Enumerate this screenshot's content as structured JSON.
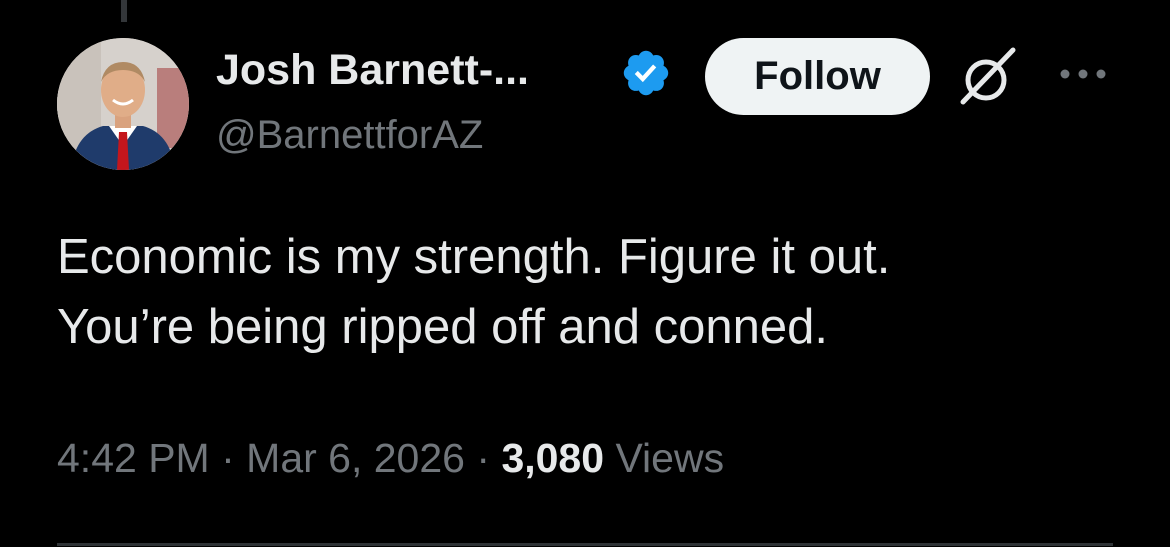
{
  "author": {
    "display_name": "Josh Barnett-...",
    "handle": "@BarnettforAZ",
    "verified_icon": "verified-badge-icon",
    "verified_color": "#1d9bf0"
  },
  "actions": {
    "follow_label": "Follow",
    "grok_icon": "grok-icon",
    "more_icon": "more-options-icon"
  },
  "tweet": {
    "lines": [
      "Economic is my strength. Figure it out.",
      "You’re being ripped off and conned."
    ]
  },
  "meta": {
    "time": "4:42 PM",
    "separator": "·",
    "date": "Mar 6, 2026",
    "views_count": "3,080",
    "views_label": "Views"
  },
  "colors": {
    "background": "#000000",
    "primary_text": "#e7e9ea",
    "secondary_text": "#71767b",
    "follow_bg": "#eff3f4"
  }
}
